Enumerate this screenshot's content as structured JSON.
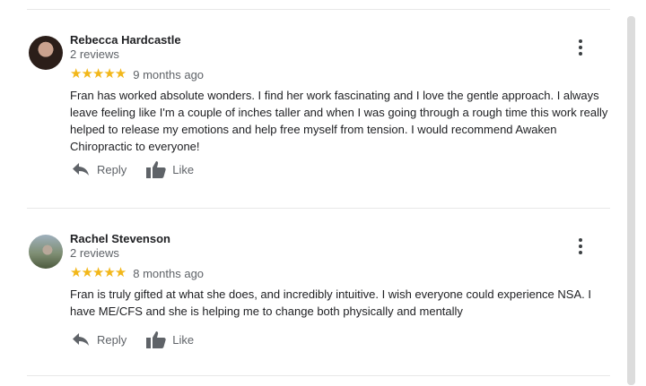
{
  "reviews": [
    {
      "author": "Rebecca Hardcastle",
      "review_count": "2 reviews",
      "stars": "★★★★★",
      "time": "9 months ago",
      "text": "Fran has worked absolute wonders. I find her work fascinating and I love the gentle approach.  I always\nleave feeling like I'm a couple of inches taller and when I was going through a rough time this work really\nhelped to release my emotions and help free myself from tension. I would recommend Awaken\nChiropractic to everyone!",
      "reply_label": "Reply",
      "like_label": "Like"
    },
    {
      "author": "Rachel Stevenson",
      "review_count": "2 reviews",
      "stars": "★★★★★",
      "time": "8 months ago",
      "text": "Fran is truly gifted at what she does, and incredibly intuitive. I wish everyone could experience NSA. I\nhave ME/CFS and she is helping me to change both physically and mentally",
      "reply_label": "Reply",
      "like_label": "Like"
    }
  ],
  "icons": {
    "reply": "reply-icon",
    "like": "thumbs-up-icon",
    "more": "more-vertical-icon"
  },
  "colors": {
    "star": "#f2b71a",
    "secondary_text": "#5f6368",
    "icon": "#5f6368"
  }
}
